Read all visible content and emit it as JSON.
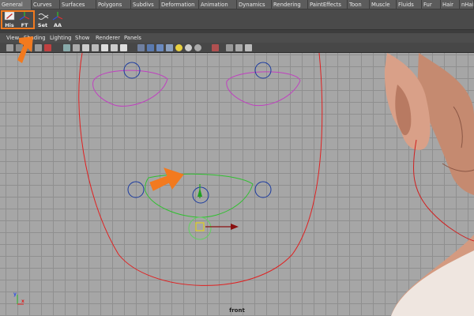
{
  "shelf_tabs": [
    "General",
    "Curves",
    "Surfaces",
    "Polygons",
    "Subdivs",
    "Deformation",
    "Animation",
    "Dynamics",
    "Rendering",
    "PaintEffects",
    "Toon",
    "Muscle",
    "Fluids",
    "Fur",
    "Hair",
    "nHair"
  ],
  "shelf_buttons": [
    {
      "label": "His",
      "icon": "history-icon"
    },
    {
      "label": "FT",
      "icon": "freeze-transform-icon"
    },
    {
      "label": "Set",
      "icon": "set-key-icon"
    },
    {
      "label": "AA",
      "icon": "aim-constraint-icon"
    }
  ],
  "panel_menu": [
    "View",
    "Shading",
    "Lighting",
    "Show",
    "Renderer",
    "Panels"
  ],
  "viewport": {
    "camera_label": "front",
    "axis_x": "x",
    "axis_y": "y"
  },
  "colors": {
    "highlight": "#f27a1f",
    "annotation_arrow": "#f27a1f",
    "curve_red": "#e02020",
    "curve_magenta": "#c040c0",
    "curve_green": "#30c030",
    "curve_blue": "#1a3aa0",
    "skin": "#d49a80"
  }
}
